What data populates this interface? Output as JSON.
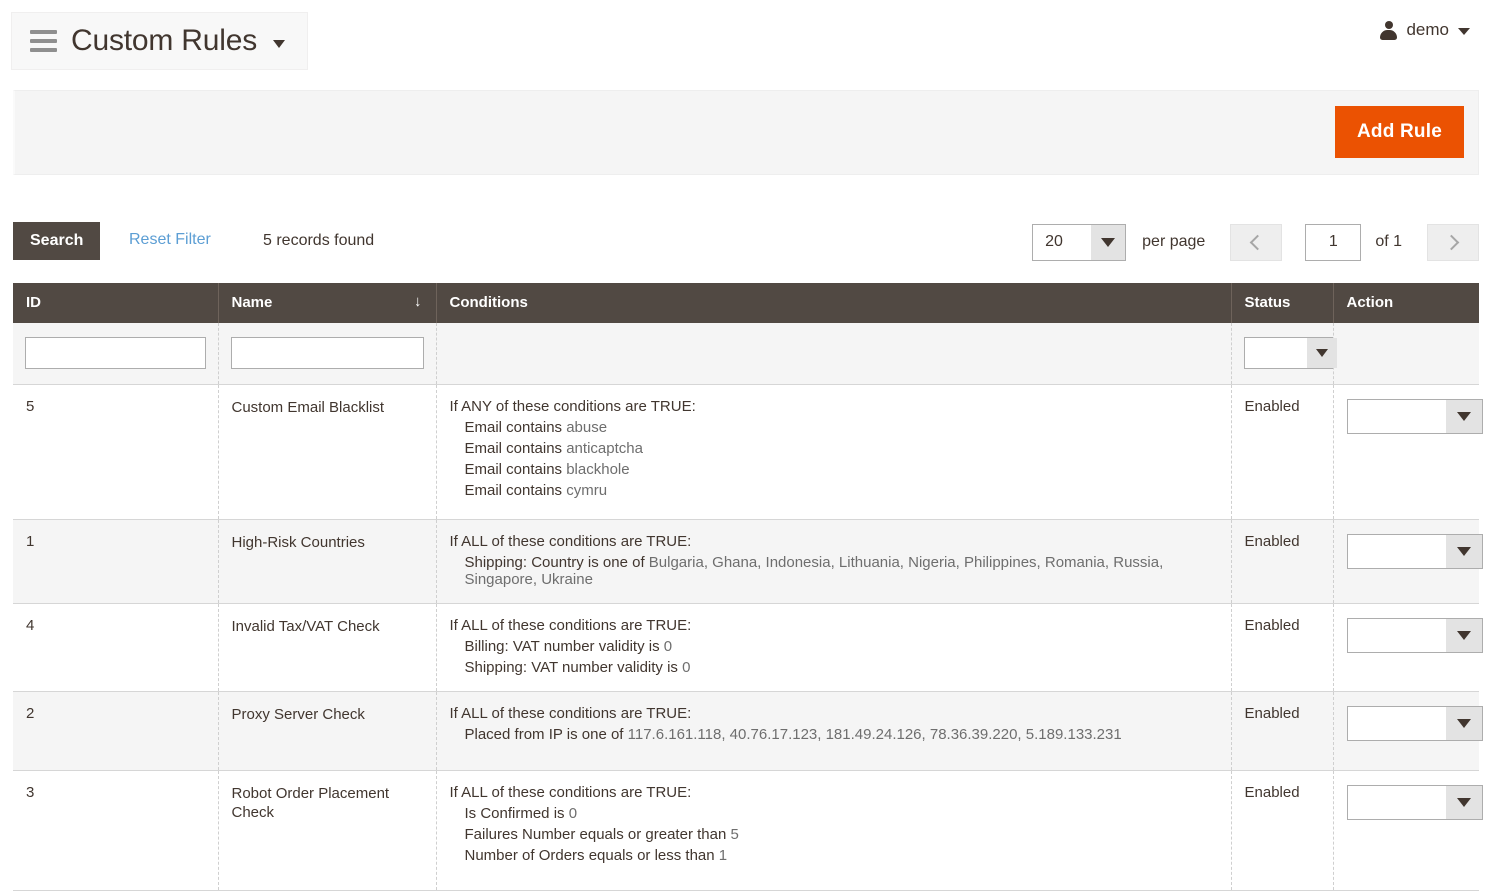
{
  "header": {
    "title": "Custom Rules",
    "menu_icon": "hamburger-icon",
    "title_caret": "chevron-down-icon",
    "user_name": "demo",
    "user_icon": "user-icon",
    "user_caret": "chevron-down-icon"
  },
  "action_bar": {
    "add_rule_label": "Add Rule"
  },
  "toolbar": {
    "search_label": "Search",
    "reset_filter_label": "Reset Filter",
    "records_found": "5 records found",
    "per_page_value": "20",
    "per_page_label": "per page",
    "prev_icon": "chevron-left-icon",
    "next_icon": "chevron-right-icon",
    "current_page": "1",
    "of_pages": "of 1"
  },
  "grid": {
    "columns": [
      {
        "key": "id",
        "label": "ID",
        "sorted": false
      },
      {
        "key": "name",
        "label": "Name",
        "sorted": true,
        "sort_indicator": "↓"
      },
      {
        "key": "conditions",
        "label": "Conditions",
        "sorted": false
      },
      {
        "key": "status",
        "label": "Status",
        "sorted": false
      },
      {
        "key": "action",
        "label": "Action",
        "sorted": false
      }
    ],
    "filters": {
      "id_value": "",
      "name_value": "",
      "status_value": ""
    },
    "rows": [
      {
        "id": "5",
        "name": "Custom Email Blacklist",
        "conditions_header": "If ANY of these conditions are TRUE:",
        "conditions_lines": [
          {
            "text": "Email contains ",
            "value": "abuse"
          },
          {
            "text": "Email contains ",
            "value": "anticaptcha"
          },
          {
            "text": "Email contains ",
            "value": "blackhole"
          },
          {
            "text": "Email contains ",
            "value": "cymru"
          }
        ],
        "status": "Enabled",
        "action_value": ""
      },
      {
        "id": "1",
        "name": "High-Risk Countries",
        "conditions_header": "If ALL of these conditions are TRUE:",
        "conditions_lines": [
          {
            "text": "Shipping: Country is one of ",
            "value": "Bulgaria, Ghana, Indonesia, Lithuania, Nigeria, Philippines, Romania, Russia, Singapore, Ukraine"
          }
        ],
        "status": "Enabled",
        "action_value": ""
      },
      {
        "id": "4",
        "name": "Invalid Tax/VAT Check",
        "conditions_header": "If ALL of these conditions are TRUE:",
        "conditions_lines": [
          {
            "text": "Billing: VAT number validity is ",
            "value": "0"
          },
          {
            "text": "Shipping: VAT number validity is ",
            "value": "0"
          }
        ],
        "status": "Enabled",
        "action_value": ""
      },
      {
        "id": "2",
        "name": "Proxy Server Check",
        "conditions_header": "If ALL of these conditions are TRUE:",
        "conditions_lines": [
          {
            "text": "Placed from IP is one of ",
            "value": "117.6.161.118, 40.76.17.123, 181.49.24.126, 78.36.39.220, 5.189.133.231"
          }
        ],
        "status": "Enabled",
        "action_value": ""
      },
      {
        "id": "3",
        "name": "Robot Order Placement Check",
        "conditions_header": "If ALL of these conditions are TRUE:",
        "conditions_lines": [
          {
            "text": "Is Confirmed is ",
            "value": "0"
          },
          {
            "text": "Failures Number equals or greater than ",
            "value": "5"
          },
          {
            "text": "Number of Orders equals or less than ",
            "value": "1"
          }
        ],
        "status": "Enabled",
        "action_value": ""
      }
    ]
  },
  "colors": {
    "accent_orange": "#eb5202",
    "header_brown": "#514943",
    "link_blue": "#5c9ed4",
    "text_dark": "#41362f",
    "value_gray": "#6e6e6e"
  }
}
